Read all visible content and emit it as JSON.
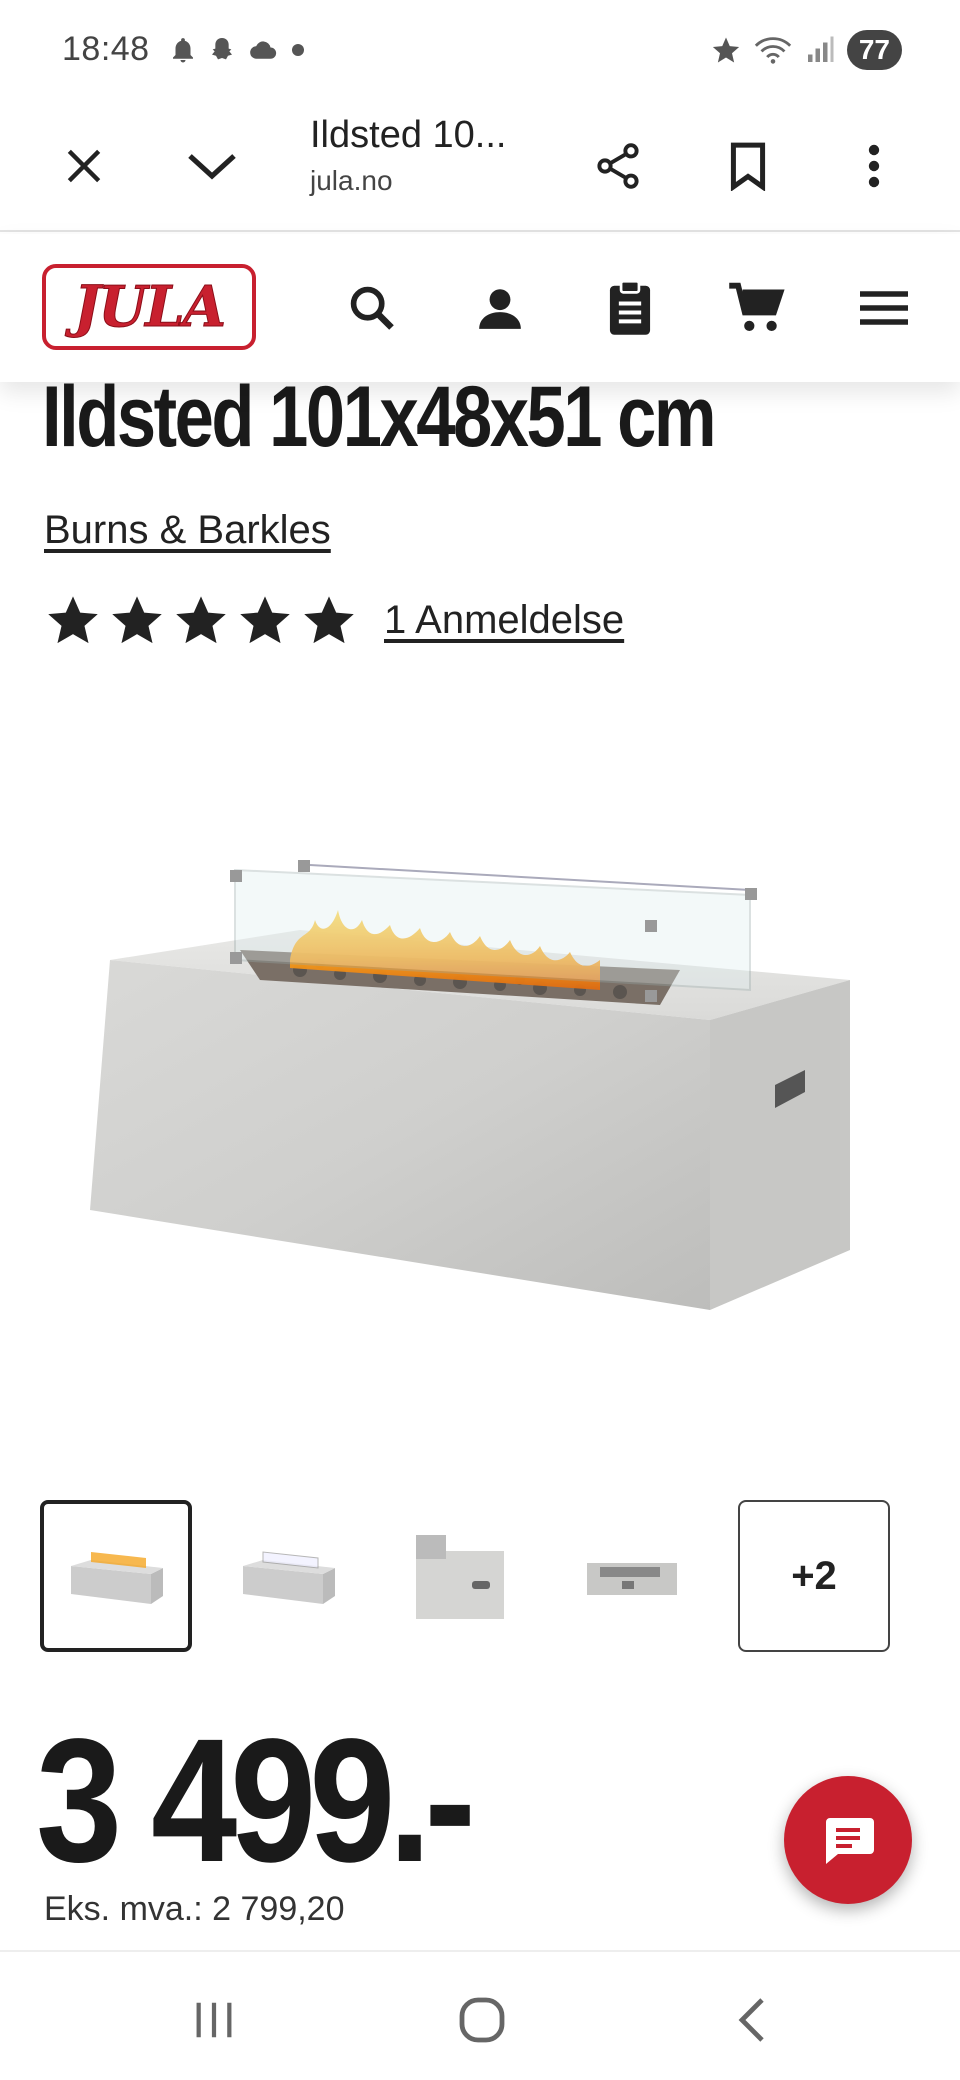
{
  "status_bar": {
    "time": "18:48",
    "battery": "77",
    "icons_left": [
      "bell-icon",
      "snapchat-icon",
      "cloud-icon",
      "dot-icon"
    ],
    "icons_right": [
      "star-icon",
      "wifi-icon",
      "signal-icon",
      "battery-icon"
    ]
  },
  "browser": {
    "title": "Ildsted 10...",
    "url": "jula.no",
    "buttons": [
      "close-icon",
      "chevron-down-icon",
      "share-icon",
      "bookmark-icon",
      "more-vertical-icon"
    ]
  },
  "site_header": {
    "logo_text": "JULA",
    "icons": [
      "search-icon",
      "account-icon",
      "shopping-list-icon",
      "cart-icon",
      "menu-icon"
    ]
  },
  "product": {
    "title": "Ildsted 101x48x51 cm",
    "brand": "Burns & Barkles",
    "rating_stars": 5,
    "reviews": "1 Anmeldelse",
    "thumbnails_more": "+2",
    "price": "3 499.-",
    "price_ex_vat": "Eks. mva.: 2 799,20"
  },
  "colors": {
    "brand_red": "#c8202f",
    "text_dark": "#1a1a1a"
  }
}
